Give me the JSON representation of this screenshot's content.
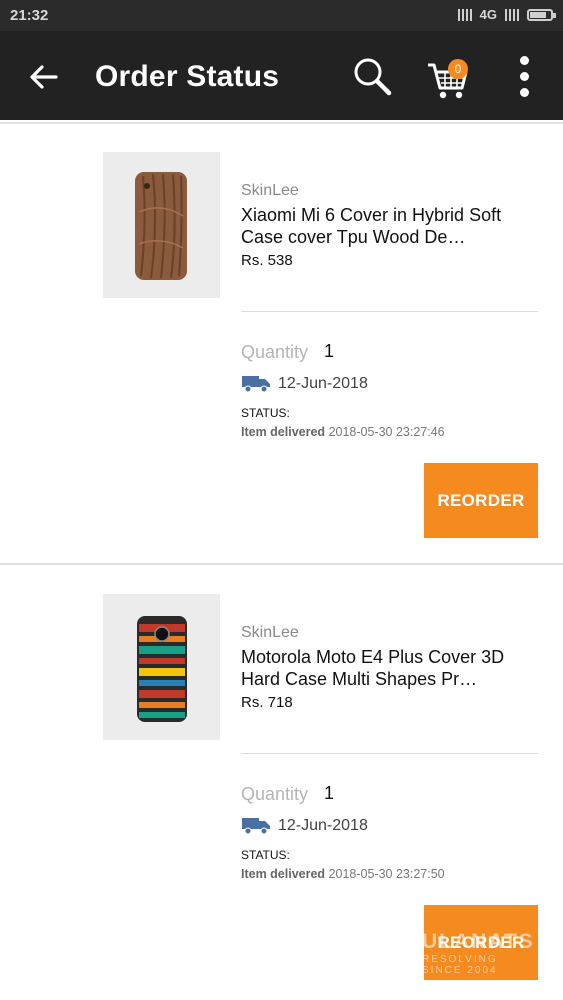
{
  "status_bar": {
    "time": "21:32",
    "network": "4G"
  },
  "app_bar": {
    "title": "Order Status",
    "cart_count": "0",
    "icons": [
      "back-arrow-icon",
      "search-icon",
      "cart-icon",
      "more-vert-icon"
    ]
  },
  "orders": [
    {
      "brand": "SkinLee",
      "name": "Xiaomi Mi 6 Cover in Hybrid Soft Case cover Tpu Wood De…",
      "price": "Rs. 538",
      "quantity_label": "Quantity",
      "quantity": "1",
      "delivery_date": "12-Jun-2018",
      "status_label": "STATUS:",
      "status": "Item delivered",
      "status_time": "2018-05-30 23:27:46",
      "button": "REORDER"
    },
    {
      "brand": "SkinLee",
      "name": "Motorola Moto E4 Plus Cover 3D Hard Case Multi Shapes Pr…",
      "price": "Rs. 718",
      "quantity_label": "Quantity",
      "quantity": "1",
      "delivery_date": "12-Jun-2018",
      "status_label": "STATUS:",
      "status": "Item delivered",
      "status_time": "2018-05-30 23:27:50",
      "button": "REORDER"
    }
  ],
  "watermark": {
    "line1": "ULANATS",
    "line2": "RESOLVING",
    "line3": "SINCE 2004"
  },
  "colors": {
    "accent": "#f58a1f",
    "app_bar": "#222222",
    "truck": "#4a6fa5"
  }
}
